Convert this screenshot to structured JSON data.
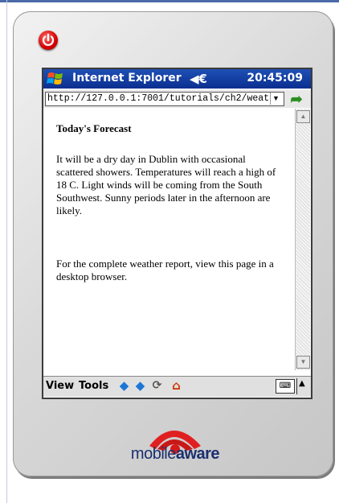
{
  "window": {
    "app_title": "Internet Explorer",
    "speaker_symbol": "◀€",
    "clock": "20:45:09"
  },
  "address_bar": {
    "url": "http://127.0.0.1:7001/tutorials/ch2/weat",
    "dropdown_symbol": "▼",
    "go_symbol": "➦"
  },
  "page": {
    "heading": "Today's Forecast",
    "paragraph_1": "It will be a dry day in Dublin with occasional scattered showers. Temperatures will reach a high of 18 C. Light winds will be coming from the South Southwest. Sunny periods later in the afternoon are likely.",
    "paragraph_2": "For the complete weather report, view this page in a desktop browser."
  },
  "scrollbar": {
    "up_symbol": "▲",
    "down_symbol": "▼"
  },
  "menu": {
    "view_label": "View",
    "tools_label": "Tools",
    "back_symbol": "◆",
    "forward_symbol": "◆",
    "refresh_symbol": "⟳",
    "home_symbol": "⌂",
    "keyboard_symbol": "⌨",
    "input_arrow_symbol": "▲"
  },
  "brand": {
    "part_1": "mobile",
    "part_2": "aware"
  },
  "colors": {
    "titlebar": "#0a2f8f",
    "power_button": "#d40000",
    "logo_red": "#e02020",
    "brand_text": "#1b2f6e"
  }
}
